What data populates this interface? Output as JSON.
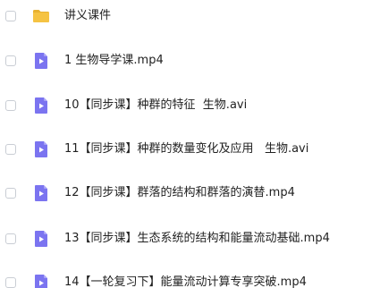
{
  "files": [
    {
      "type": "folder-icon",
      "name": "讲义课件"
    },
    {
      "type": "video-file-icon",
      "name": "1 生物导学课.mp4"
    },
    {
      "type": "video-file-icon",
      "name": "10【同步课】种群的特征  生物.avi"
    },
    {
      "type": "video-file-icon",
      "name": "11【同步课】种群的数量变化及应用   生物.avi"
    },
    {
      "type": "video-file-icon",
      "name": "12【同步课】群落的结构和群落的演替.mp4"
    },
    {
      "type": "video-file-icon",
      "name": "13【同步课】生态系统的结构和能量流动基础.mp4"
    },
    {
      "type": "video-file-icon",
      "name": "14【一轮复习下】能量流动计算专享突破.mp4"
    }
  ],
  "colors": {
    "folder": "#f5c343",
    "folder_tab": "#e8b232",
    "video_icon": "#7b74f0",
    "video_fold": "#a9a4f7",
    "checkbox_border": "#c9cdd4"
  }
}
